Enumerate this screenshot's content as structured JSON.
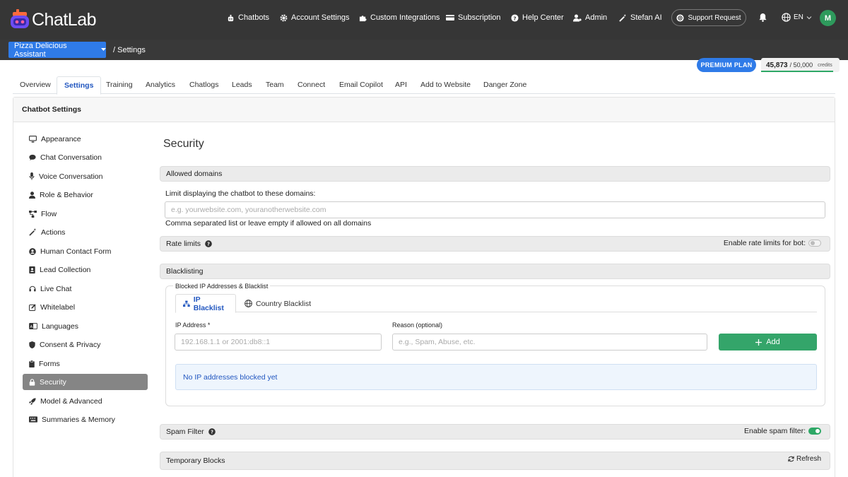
{
  "app": {
    "name": "ChatLab"
  },
  "nav": {
    "chatbots": "Chatbots",
    "account_settings": "Account Settings",
    "custom_integrations": "Custom Integrations",
    "subscription": "Subscription",
    "help_center": "Help Center",
    "admin": "Admin",
    "stefan_ai": "Stefan AI",
    "support_request": "Support Request",
    "language": "EN",
    "avatar_initial": "M"
  },
  "subheader": {
    "bot_selector": "Pizza Delicious Assistant",
    "breadcrumb": "/ Settings"
  },
  "plan": {
    "label": "PREMIUM PLAN",
    "credits_used": "45,873",
    "credits_max": "/ 50,000",
    "credits_unit": "credits",
    "credits_fraction": 0.917
  },
  "tabs": [
    "Overview",
    "Settings",
    "Training",
    "Analytics",
    "Chatlogs",
    "Leads",
    "Team",
    "Connect",
    "Email Copilot",
    "API",
    "Add to Website",
    "Danger Zone"
  ],
  "active_tab": "Settings",
  "card": {
    "title": "Chatbot Settings"
  },
  "sidebar": {
    "items": [
      {
        "label": "Appearance",
        "icon": "monitor-icon"
      },
      {
        "label": "Chat Conversation",
        "icon": "comment-icon"
      },
      {
        "label": "Voice Conversation",
        "icon": "microphone-icon"
      },
      {
        "label": "Role & Behavior",
        "icon": "user-icon"
      },
      {
        "label": "Flow",
        "icon": "flow-icon"
      },
      {
        "label": "Actions",
        "icon": "magic-wand-icon"
      },
      {
        "label": "Human Contact Form",
        "icon": "user-circle-icon"
      },
      {
        "label": "Lead Collection",
        "icon": "contact-book-icon"
      },
      {
        "label": "Live Chat",
        "icon": "headset-icon"
      },
      {
        "label": "Whitelabel",
        "icon": "edit-icon"
      },
      {
        "label": "Languages",
        "icon": "language-icon"
      },
      {
        "label": "Consent & Privacy",
        "icon": "shield-icon"
      },
      {
        "label": "Forms",
        "icon": "clipboard-icon"
      },
      {
        "label": "Security",
        "icon": "lock-icon"
      },
      {
        "label": "Model & Advanced",
        "icon": "rocket-icon"
      },
      {
        "label": "Summaries & Memory",
        "icon": "keyboard-icon"
      }
    ],
    "active": "Security"
  },
  "security": {
    "title": "Security",
    "allowed_domains": {
      "header": "Allowed domains",
      "label": "Limit displaying the chatbot to these domains:",
      "placeholder": "e.g. yourwebsite.com, youranotherwebsite.com",
      "help": "Comma separated list or leave empty if allowed on all domains"
    },
    "rate_limits": {
      "header": "Rate limits",
      "toggle_label": "Enable rate limits for bot:",
      "enabled": false
    },
    "blacklisting": {
      "header": "Blacklisting",
      "legend": "Blocked IP Addresses & Blacklist",
      "tabs": [
        {
          "label": "IP Blacklist",
          "icon": "network-icon"
        },
        {
          "label": "Country Blacklist",
          "icon": "globe-icon"
        }
      ],
      "active_tab": "IP Blacklist",
      "ip_label": "IP Address *",
      "ip_placeholder": "192.168.1.1 or 2001:db8::1",
      "reason_label": "Reason (optional)",
      "reason_placeholder": "e.g., Spam, Abuse, etc.",
      "add_label": "Add",
      "empty_message": "No IP addresses blocked yet"
    },
    "spam_filter": {
      "header": "Spam Filter",
      "toggle_label": "Enable spam filter:",
      "enabled": true
    },
    "temporary_blocks": {
      "header": "Temporary Blocks",
      "refresh_label": "Refresh"
    }
  },
  "colors": {
    "accent": "#2f7be8",
    "success": "#34a56a",
    "topbar": "#363636"
  }
}
